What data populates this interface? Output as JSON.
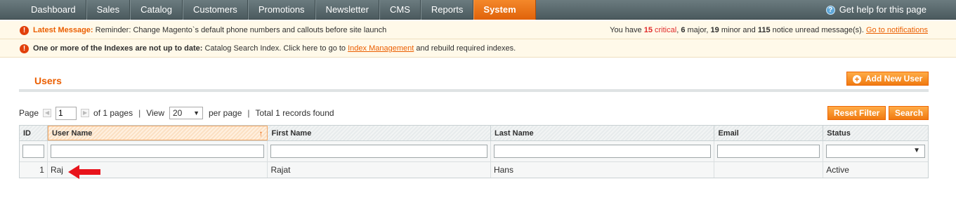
{
  "nav": {
    "items": [
      {
        "label": "Dashboard"
      },
      {
        "label": "Sales"
      },
      {
        "label": "Catalog"
      },
      {
        "label": "Customers"
      },
      {
        "label": "Promotions"
      },
      {
        "label": "Newsletter"
      },
      {
        "label": "CMS"
      },
      {
        "label": "Reports"
      },
      {
        "label": "System",
        "active": true
      }
    ],
    "help_label": "Get help for this page"
  },
  "notices": {
    "latest_label": "Latest Message:",
    "latest_text": "Reminder: Change Magento`s default phone numbers and callouts before site launch",
    "summary": {
      "prefix": "You have",
      "critical_count": "15",
      "critical_label": "critical",
      "major": "6",
      "major_label": "major,",
      "minor": "19",
      "minor_label": "minor and",
      "notice": "115",
      "notice_label": "notice unread message(s).",
      "link": "Go to notifications"
    },
    "index_label": "One or more of the Indexes are not up to date:",
    "index_text": "Catalog Search Index. Click here to go to",
    "index_link": "Index Management",
    "index_suffix": "and rebuild required indexes."
  },
  "page": {
    "title": "Users",
    "add_button": "Add New User",
    "reset_button": "Reset Filter",
    "search_button": "Search"
  },
  "pager": {
    "page_label": "Page",
    "page_value": "1",
    "of_pages": "of 1 pages",
    "view_label": "View",
    "view_value": "20",
    "per_page": "per page",
    "total": "Total 1 records found"
  },
  "grid": {
    "headers": {
      "id": "ID",
      "username": "User Name",
      "firstname": "First Name",
      "lastname": "Last Name",
      "email": "Email",
      "status": "Status"
    },
    "sort_indicator": "↑",
    "rows": [
      {
        "id": "1",
        "username": "Raj",
        "firstname": "Rajat",
        "lastname": "Hans",
        "email": "",
        "status": "Active"
      }
    ]
  },
  "colors": {
    "accent": "#eb5e00",
    "nav_bg": "#5b6a6e",
    "notice_bg": "#fff9e9",
    "annotation_arrow": "#e8141c"
  }
}
